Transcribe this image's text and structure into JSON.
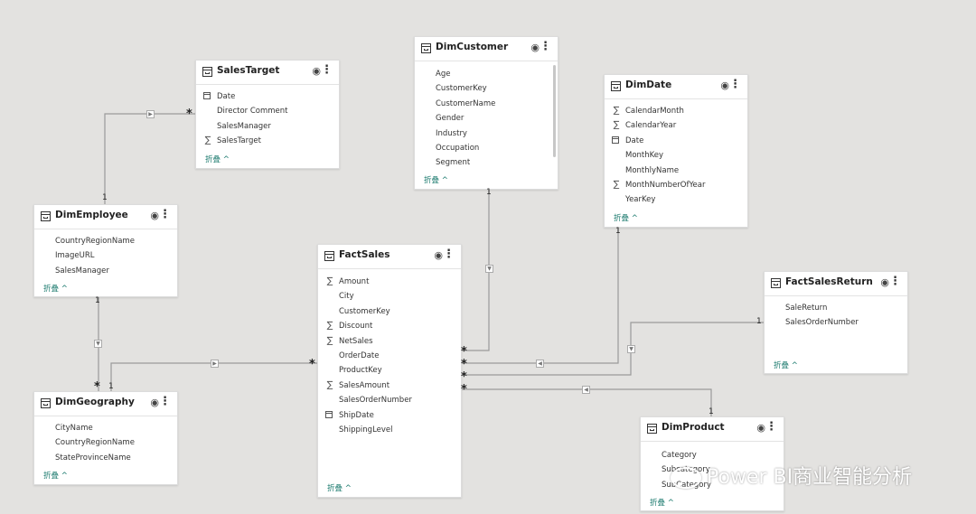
{
  "tables": {
    "salestarget": {
      "title": "SalesTarget",
      "fields": [
        "Date",
        "Director Comment",
        "SalesManager",
        "SalesTarget"
      ],
      "collapse": "折叠 ^"
    },
    "dimcustomer": {
      "title": "DimCustomer",
      "fields": [
        "Age",
        "CustomerKey",
        "CustomerName",
        "Gender",
        "Industry",
        "Occupation",
        "Segment"
      ],
      "collapse": "折叠 ^"
    },
    "dimdate": {
      "title": "DimDate",
      "fields": [
        "CalendarMonth",
        "CalendarYear",
        "Date",
        "MonthKey",
        "MonthlyName",
        "MonthNumberOfYear",
        "YearKey"
      ],
      "collapse": "折叠 ^"
    },
    "dimemployee": {
      "title": "DimEmployee",
      "fields": [
        "CountryRegionName",
        "ImageURL",
        "SalesManager"
      ],
      "collapse": "折叠 ^"
    },
    "factsales": {
      "title": "FactSales",
      "fields": [
        "Amount",
        "City",
        "CustomerKey",
        "Discount",
        "NetSales",
        "OrderDate",
        "ProductKey",
        "SalesAmount",
        "SalesOrderNumber",
        "ShipDate",
        "ShippingLevel"
      ],
      "collapse": "折叠 ^"
    },
    "factsalesreturn": {
      "title": "FactSalesReturn",
      "fields": [
        "SaleReturn",
        "SalesOrderNumber"
      ],
      "collapse": "折叠 ^"
    },
    "dimgeography": {
      "title": "DimGeography",
      "fields": [
        "CityName",
        "CountryRegionName",
        "StateProvinceName"
      ],
      "collapse": "折叠 ^"
    },
    "dimproduct": {
      "title": "DimProduct",
      "fields": [
        "Category",
        "Subcategory",
        "SubCategory"
      ],
      "collapse": "折叠 ^"
    }
  },
  "cardinality": {
    "one": "1",
    "many": "*"
  },
  "watermark": "Power BI商业智能分析"
}
